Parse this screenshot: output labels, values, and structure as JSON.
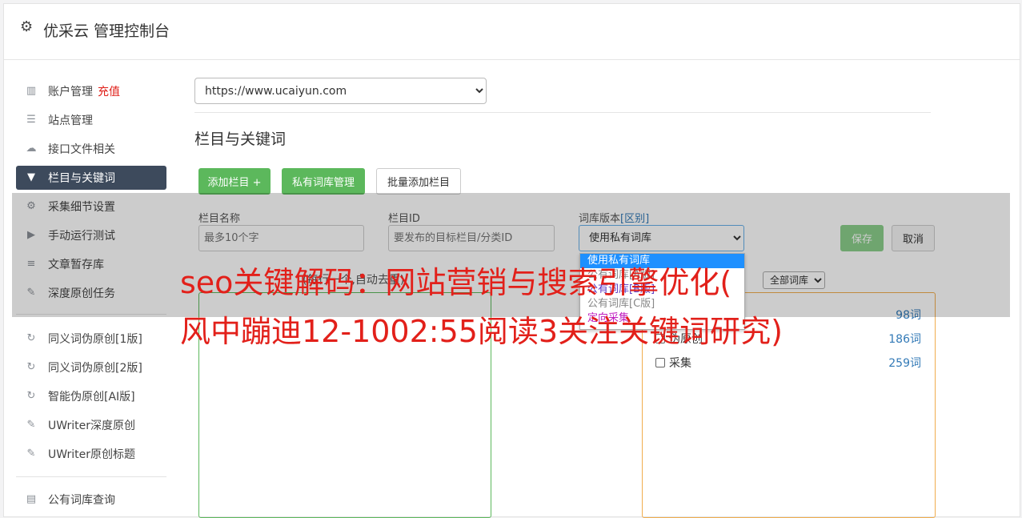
{
  "header": {
    "title": "优采云 管理控制台",
    "icon": "gear-icon"
  },
  "sidebar": {
    "items": [
      {
        "label": "账户管理",
        "icon": "bar-chart-icon",
        "extra": "充值"
      },
      {
        "label": "站点管理",
        "icon": "server-icon"
      },
      {
        "label": "接口文件相关",
        "icon": "cloud-upload-icon"
      },
      {
        "label": "栏目与关键词",
        "icon": "filter-icon",
        "active": true
      },
      {
        "label": "采集细节设置",
        "icon": "gears-icon"
      },
      {
        "label": "手动运行测试",
        "icon": "play-circle-icon"
      },
      {
        "label": "文章暂存库",
        "icon": "database-icon"
      },
      {
        "label": "深度原创任务",
        "icon": "edit-icon"
      },
      {
        "label": "同义词伪原创[1版]",
        "icon": "refresh-icon"
      },
      {
        "label": "同义词伪原创[2版]",
        "icon": "refresh-icon"
      },
      {
        "label": "智能伪原创[AI版]",
        "icon": "refresh-icon"
      },
      {
        "label": "UWriter深度原创",
        "icon": "edit-icon"
      },
      {
        "label": "UWriter原创标题",
        "icon": "edit-icon"
      },
      {
        "label": "公有词库查询",
        "icon": "book-icon"
      }
    ]
  },
  "main": {
    "site_select": "https://www.ucaiyun.com",
    "section_title": "栏目与关键词",
    "buttons": {
      "add_column": "添加栏目 +",
      "private_lib": "私有词库管理",
      "batch_add": "批量添加栏目",
      "save": "保存",
      "cancel": "取消"
    },
    "form": {
      "name_label": "栏目名称",
      "name_placeholder": "最多10个字",
      "id_label": "栏目ID",
      "id_placeholder": "要发布的目标栏目/分类ID",
      "version_label_prefix": "词库版本",
      "version_label_link": "[区别]",
      "version_selected": "使用私有词库",
      "version_options": [
        "使用私有词库",
        "公有词库[A版]",
        "公有词库[B版]",
        "公有词库[C版]",
        "定向采集"
      ],
      "partial_hint": "(每行一个,自动去重)",
      "lib_filter": "全部词库"
    },
    "libraries": [
      {
        "name": "原创",
        "count": "98词"
      },
      {
        "name": "伪原创",
        "count": "186词"
      },
      {
        "name": "采集",
        "count": "259词"
      }
    ]
  },
  "watermark": {
    "line1": "seo关键解码：网站营销与搜索引擎优化(",
    "line2": "风中蹦迪12-1002:55阅读3关注关键词研究)"
  },
  "colors": {
    "accent_green": "#5cb85c",
    "active_nav": "#3d4a5c",
    "link_blue": "#337ab7",
    "watermark_red": "#e2201a",
    "recharge_red": "#e0201a"
  }
}
